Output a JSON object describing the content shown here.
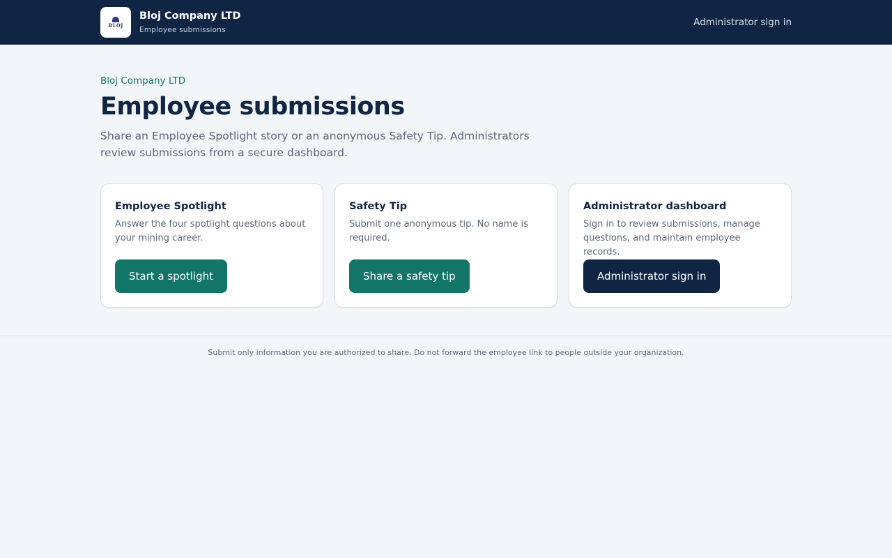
{
  "header": {
    "company": "Bloj Company LTD",
    "subtitle": "Employee submissions",
    "logo_text": "BLOJ",
    "admin_link": "Administrator sign in"
  },
  "main": {
    "eyebrow": "Bloj Company LTD",
    "title": "Employee submissions",
    "intro": "Share an Employee Spotlight story or an anonymous Safety Tip. Administrators review submissions from a secure dashboard."
  },
  "cards": [
    {
      "title": "Employee Spotlight",
      "description": "Answer the four spotlight questions about your mining career.",
      "button": "Start a spotlight"
    },
    {
      "title": "Safety Tip",
      "description": "Submit one anonymous tip. No name is required.",
      "button": "Share a safety tip"
    },
    {
      "title": "Administrator dashboard",
      "description": "Sign in to review submissions, manage questions, and maintain employee records.",
      "button": "Administrator sign in"
    }
  ],
  "footer": {
    "notice": "Submit only information you are authorized to share. Do not forward the employee link to people outside your organization."
  },
  "colors": {
    "header_bg": "#102544",
    "accent_teal": "#127568",
    "eyebrow": "#137366",
    "page_bg": "#f2f6f9"
  }
}
